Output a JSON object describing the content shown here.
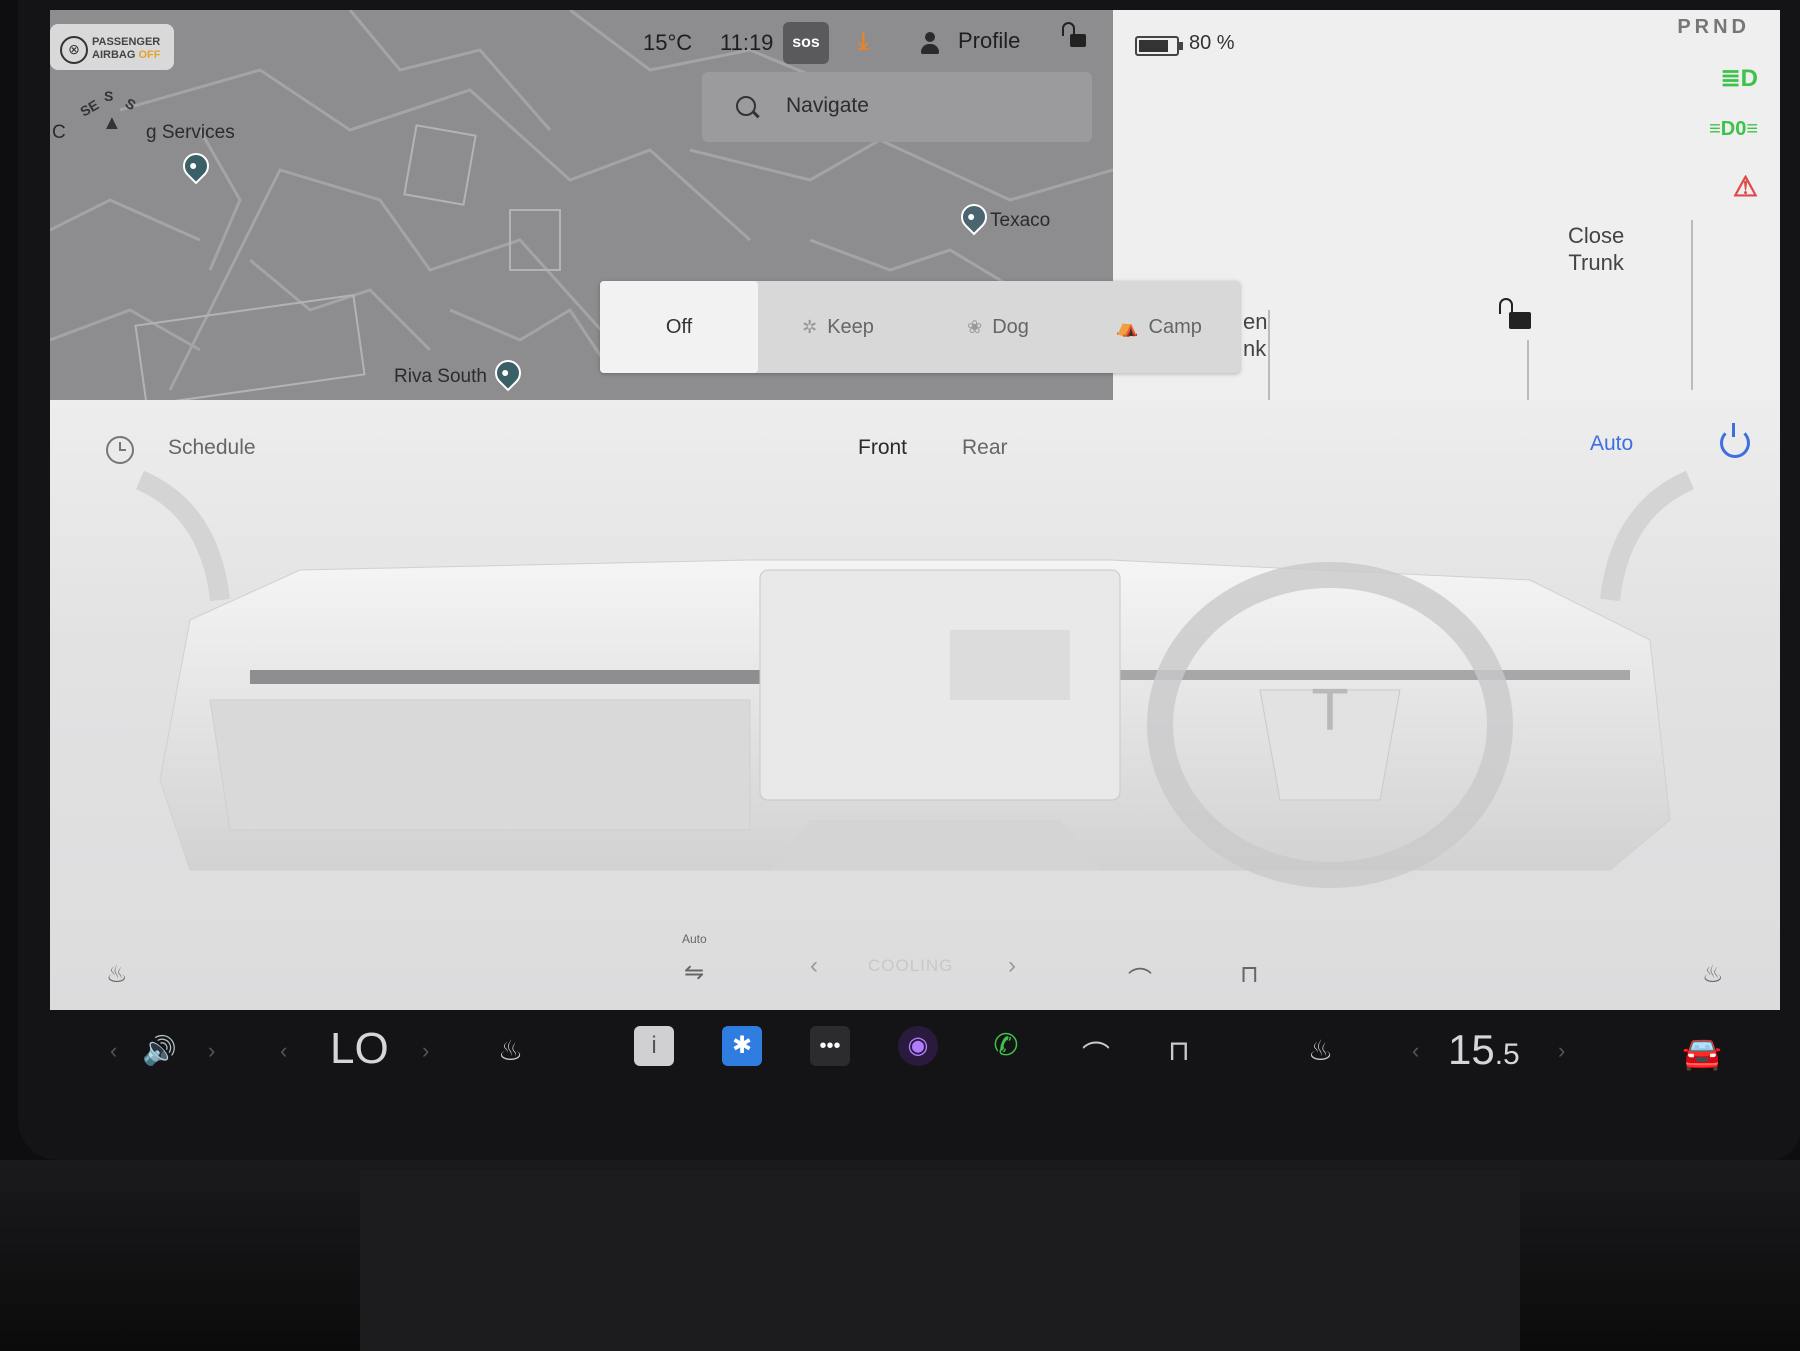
{
  "airbag": {
    "line1": "PASSENGER",
    "line2": "AIRBAG",
    "line2_state": "OFF"
  },
  "compass": {
    "n1": "SE",
    "n2": "S",
    "n3": "S"
  },
  "map": {
    "labels": [
      "C",
      "g Services",
      "Texaco",
      "Riva South"
    ]
  },
  "status": {
    "temp": "15°C",
    "time": "11:19",
    "sos": "sos",
    "profile": "Profile"
  },
  "navigate": {
    "placeholder": "Navigate"
  },
  "battery": {
    "percent_text": "80 %",
    "level": 0.8
  },
  "gear": {
    "prnd": "PRND"
  },
  "trunk": {
    "close_line1": "Close",
    "close_line2": "Trunk",
    "open_partial_line1": "en",
    "open_partial_line2": "nk"
  },
  "modes": {
    "items": [
      {
        "label": "Off",
        "active": true
      },
      {
        "label": "Keep",
        "active": false
      },
      {
        "label": "Dog",
        "active": false
      },
      {
        "label": "Camp",
        "active": false
      }
    ]
  },
  "climate": {
    "schedule": "Schedule",
    "tabs": [
      "Front",
      "Rear"
    ],
    "active_tab": "Front",
    "auto": "Auto",
    "auto_small": "Auto",
    "cooling": "COOLING"
  },
  "dock": {
    "driver_temp": "LO",
    "passenger_temp_main": "15",
    "passenger_temp_dec": ".5"
  },
  "colors": {
    "accent": "#3d6fe0",
    "download": "#e6842b",
    "green": "#3fc24a",
    "red": "#e04a4a"
  }
}
